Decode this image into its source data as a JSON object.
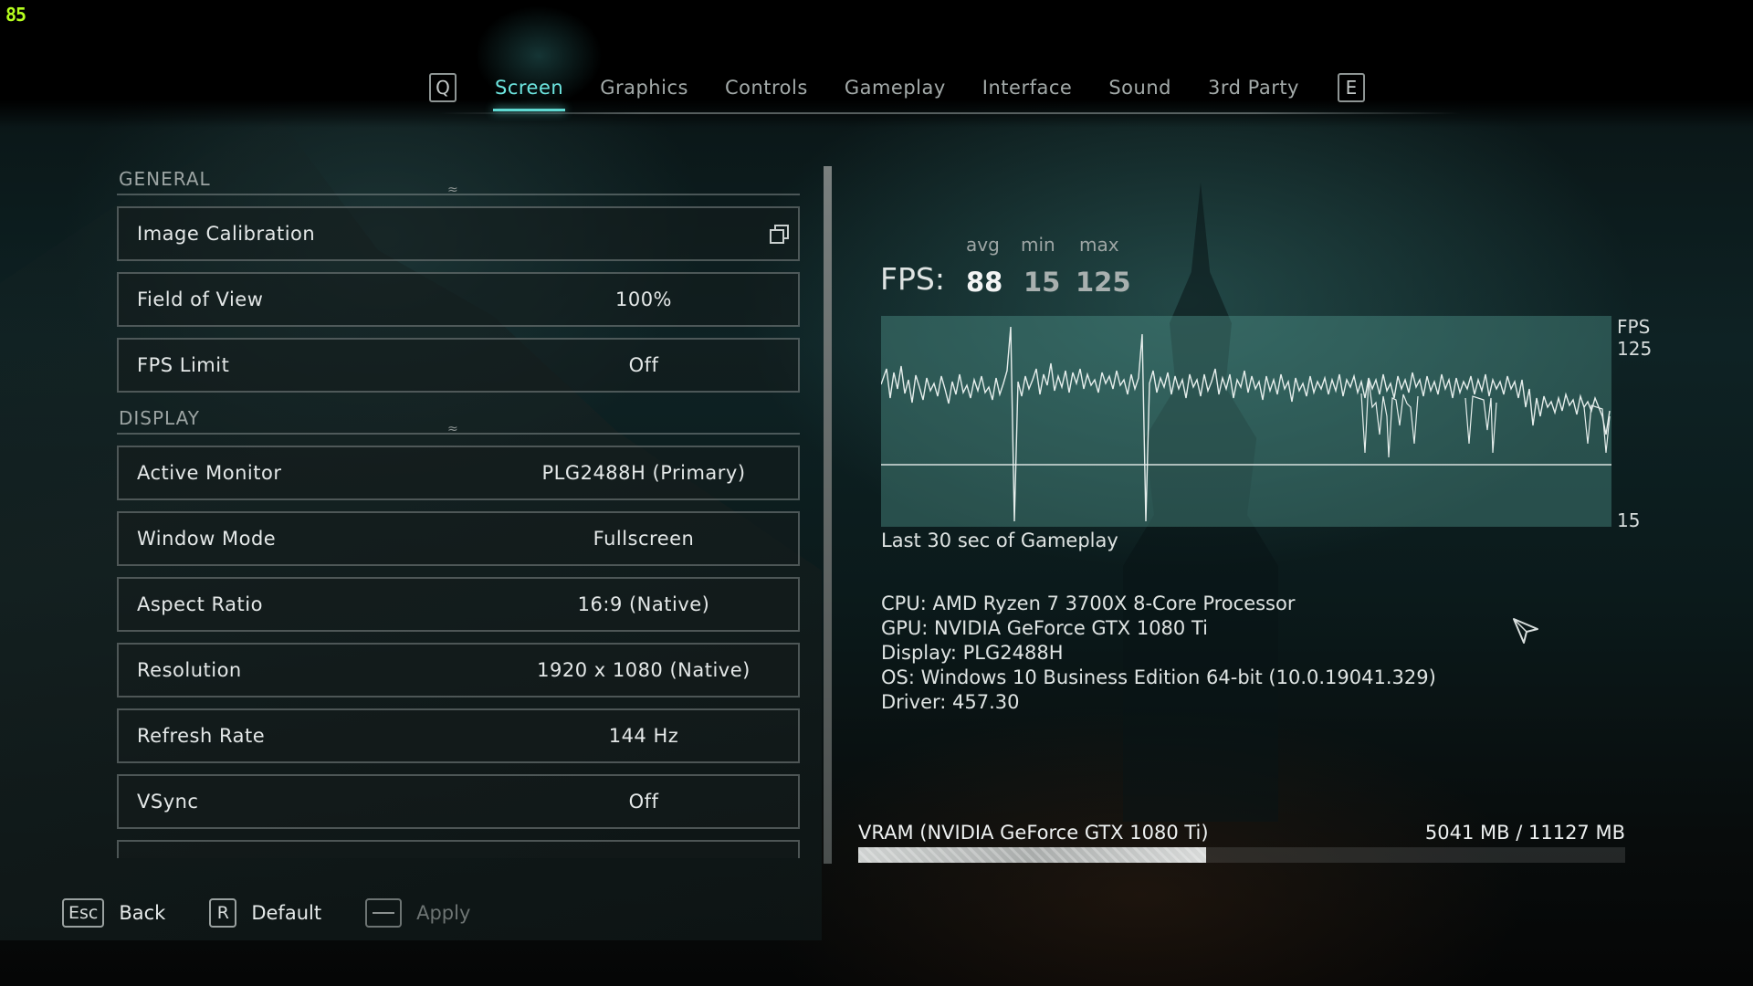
{
  "overlay": {
    "fps_counter": "85"
  },
  "nav": {
    "prev_key": "Q",
    "next_key": "E",
    "tabs": [
      {
        "label": "Screen",
        "active": true
      },
      {
        "label": "Graphics",
        "active": false
      },
      {
        "label": "Controls",
        "active": false
      },
      {
        "label": "Gameplay",
        "active": false
      },
      {
        "label": "Interface",
        "active": false
      },
      {
        "label": "Sound",
        "active": false
      },
      {
        "label": "3rd Party",
        "active": false
      }
    ]
  },
  "general": {
    "title": "GENERAL",
    "items": [
      {
        "label": "Image Calibration",
        "value": ""
      },
      {
        "label": "Field of View",
        "value": "100%"
      },
      {
        "label": "FPS Limit",
        "value": "Off"
      }
    ]
  },
  "display": {
    "title": "DISPLAY",
    "items": [
      {
        "label": "Active Monitor",
        "value": "PLG2488H (Primary)"
      },
      {
        "label": "Window Mode",
        "value": "Fullscreen"
      },
      {
        "label": "Aspect Ratio",
        "value": "16:9 (Native)"
      },
      {
        "label": "Resolution",
        "value": "1920 x 1080 (Native)"
      },
      {
        "label": "Refresh Rate",
        "value": "144 Hz"
      },
      {
        "label": "VSync",
        "value": "Off"
      }
    ]
  },
  "stats": {
    "fps_label": "FPS:",
    "avg_label": "avg",
    "min_label": "min",
    "max_label": "max",
    "avg": "88",
    "min": "15",
    "max": "125",
    "graph": {
      "axis_title": "FPS",
      "top_value": "125",
      "bottom_value": "15",
      "caption": "Last 30 sec of Gameplay"
    }
  },
  "system": {
    "cpu": "CPU: AMD Ryzen 7 3700X 8-Core Processor",
    "gpu": "GPU: NVIDIA GeForce GTX 1080 Ti",
    "display": "Display: PLG2488H",
    "os": "OS: Windows 10 Business Edition 64-bit (10.0.19041.329)",
    "driver": "Driver: 457.30"
  },
  "vram": {
    "label": "VRAM (NVIDIA GeForce GTX 1080 Ti)",
    "value": "5041 MB / 11127 MB",
    "used_mb": 5041,
    "total_mb": 11127
  },
  "footer": {
    "back_key": "Esc",
    "back_label": "Back",
    "default_key": "R",
    "default_label": "Default",
    "apply_label": "Apply"
  },
  "colors": {
    "accent": "#5fd9d2",
    "counter": "#b6ff1e",
    "graph_bg": "#4f8f87"
  }
}
